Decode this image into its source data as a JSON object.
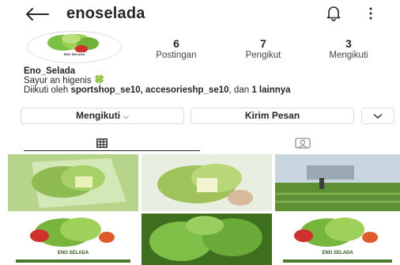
{
  "header": {
    "username": "enoselada",
    "back_icon": "arrow-left-icon",
    "notifications_icon": "bell-icon",
    "more_icon": "more-vertical-icon"
  },
  "avatar": {
    "logo_text": "ENO SELADA"
  },
  "stats": [
    {
      "count": "6",
      "label": "Postingan"
    },
    {
      "count": "7",
      "label": "Pengikut"
    },
    {
      "count": "3",
      "label": "Mengikuti"
    }
  ],
  "bio": {
    "name": "Eno_Selada",
    "line1": "Sayur an higenis 🍀",
    "followed_prefix": "Diikuti oleh ",
    "followed_names": "sportshop_se10, accesorieshp_se10",
    "followed_middle": ", dan ",
    "followed_others": "1 lainnya"
  },
  "buttons": {
    "following": "Mengikuti",
    "message": "Kirim Pesan"
  },
  "tabs": [
    {
      "name": "grid",
      "icon": "grid-icon"
    },
    {
      "name": "tagged",
      "icon": "tagged-icon"
    }
  ],
  "posts": [
    {
      "id": 1,
      "caption": "",
      "colors": [
        "#8dbb52",
        "#cfe6a5"
      ]
    },
    {
      "id": 2,
      "caption": "",
      "colors": [
        "#9fc25a",
        "#e9efe0"
      ]
    },
    {
      "id": 3,
      "caption": "",
      "colors": [
        "#5f8f35",
        "#b9c8d6"
      ]
    },
    {
      "id": 4,
      "caption": "ENO SELADA",
      "colors": [
        "#76b63c",
        "#ffffff"
      ]
    },
    {
      "id": 5,
      "caption": "",
      "colors": [
        "#3d6f1f",
        "#7fbf48"
      ]
    },
    {
      "id": 6,
      "caption": "ENO SELADA",
      "colors": [
        "#76b63c",
        "#ffffff"
      ]
    }
  ],
  "colors": {
    "text": "#262626",
    "border": "#dbdbdb",
    "muted": "#444444"
  }
}
